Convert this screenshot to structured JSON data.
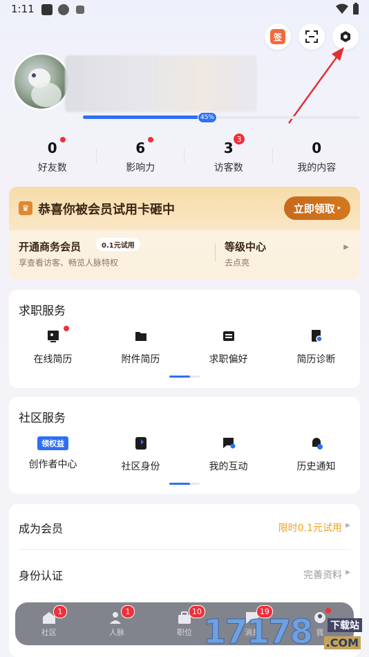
{
  "status_bar": {
    "time": "1:11"
  },
  "header": {
    "icons": [
      "checkin-icon",
      "scan-icon",
      "settings-icon"
    ],
    "checkin_label": "签",
    "profile_progress": 0.45,
    "profile_progress_label": "45%"
  },
  "stats": [
    {
      "value": "0",
      "label": "好友数",
      "badge": "dot"
    },
    {
      "value": "6",
      "label": "影响力",
      "badge": "dot"
    },
    {
      "value": "3",
      "label": "访客数",
      "badge": "3"
    },
    {
      "value": "0",
      "label": "我的内容",
      "badge": ""
    }
  ],
  "vip": {
    "title": "恭喜你被会员试用卡砸中",
    "claim_button": "立即领取",
    "left_title": "开通商务会员",
    "left_pill": "0.1元试用",
    "left_sub": "享查看访客、畅览人脉特权",
    "right_title": "等级中心",
    "right_sub": "去点亮"
  },
  "job_service": {
    "title": "求职服务",
    "items": [
      {
        "label": "在线简历",
        "icon": "online-resume-icon",
        "badge": "dot"
      },
      {
        "label": "附件简历",
        "icon": "attachment-resume-icon"
      },
      {
        "label": "求职偏好",
        "icon": "job-preference-icon"
      },
      {
        "label": "简历诊断",
        "icon": "resume-diagnosis-icon"
      }
    ]
  },
  "community_service": {
    "title": "社区服务",
    "items": [
      {
        "label": "创作者中心",
        "tag": "领权益"
      },
      {
        "label": "社区身份",
        "icon": "community-identity-icon"
      },
      {
        "label": "我的互动",
        "icon": "my-interaction-icon"
      },
      {
        "label": "历史通知",
        "icon": "history-notice-icon"
      }
    ]
  },
  "list": [
    {
      "label": "成为会员",
      "value": "限时0.1元试用",
      "value_color": "#f0a020"
    },
    {
      "label": "身份认证",
      "value": "完善资料",
      "value_color": "#999999"
    }
  ],
  "tabbar": [
    {
      "label": "社区",
      "badge": "1"
    },
    {
      "label": "人脉",
      "badge": "1"
    },
    {
      "label": "职位",
      "badge": "10"
    },
    {
      "label": "消息",
      "badge": "19"
    },
    {
      "label": "我",
      "badge": "dot"
    }
  ],
  "watermark": {
    "number": "17178",
    "text1": "下载站",
    "text2": ".COM"
  },
  "colors": {
    "accent": "#2f6ff4",
    "badge_red": "#f0303a",
    "vip_brown": "#c66a1c"
  }
}
